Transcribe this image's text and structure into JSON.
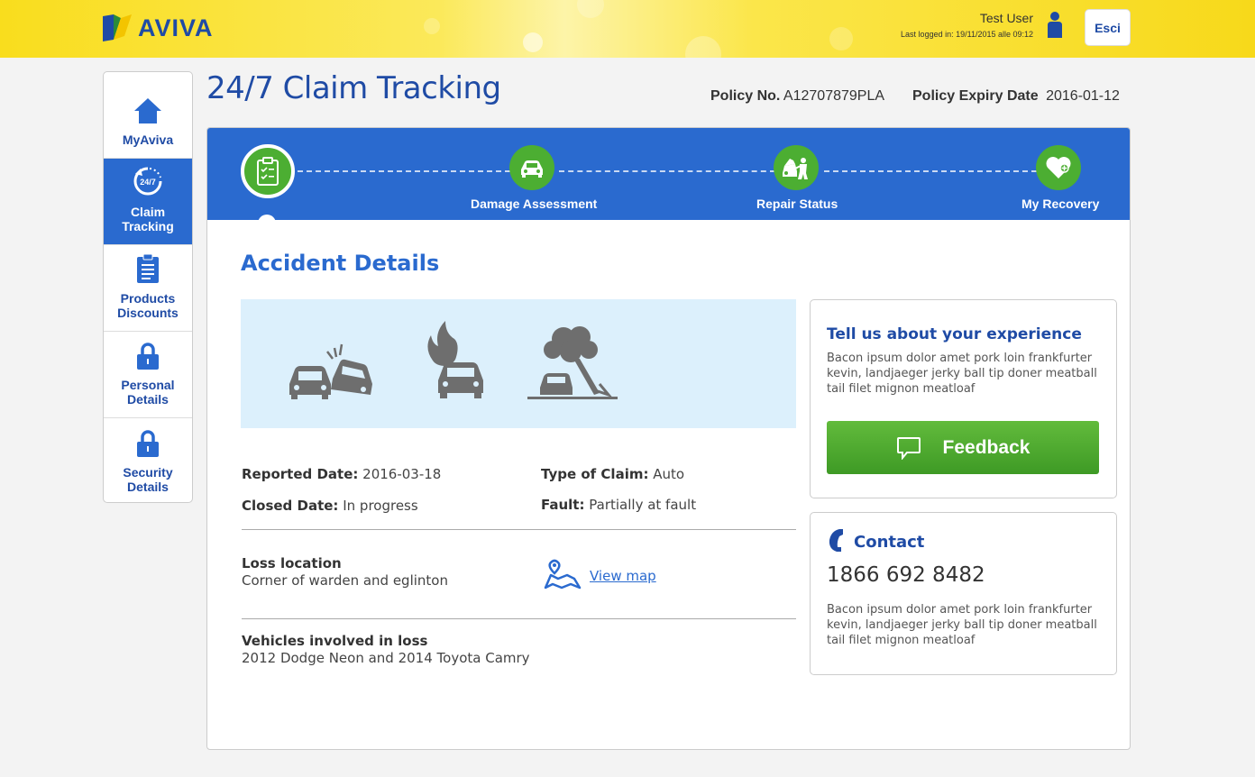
{
  "header": {
    "brand": "AVIVA",
    "user_name": "Test User",
    "last_logged": "Last logged in: 19/11/2015 alle 09:12",
    "logout_label": "Esci"
  },
  "sidebar": {
    "items": [
      {
        "label": "MyAviva",
        "icon": "home-icon",
        "active": false
      },
      {
        "label_line1": "Claim",
        "label_line2": "Tracking",
        "icon": "clock-24-7-icon",
        "active": true
      },
      {
        "label_line1": "Products",
        "label_line2": "Discounts",
        "icon": "clipboard-icon",
        "active": false
      },
      {
        "label_line1": "Personal",
        "label_line2": "Details",
        "icon": "lock-icon",
        "active": false
      },
      {
        "label_line1": "Security",
        "label_line2": "Details",
        "icon": "lock-icon",
        "active": false
      }
    ]
  },
  "page": {
    "title": "24/7 Claim Tracking",
    "policy_no_label": "Policy No.",
    "policy_no": "A12707879PLA",
    "expiry_label": "Policy Expiry Date",
    "expiry_date": "2016-01-12"
  },
  "steps": [
    {
      "label": "",
      "icon": "clipboard-check-icon",
      "current": true
    },
    {
      "label": "Damage Assessment",
      "icon": "car-icon"
    },
    {
      "label": "Repair Status",
      "icon": "mechanic-icon"
    },
    {
      "label": "My Recovery",
      "icon": "heart-plus-icon"
    }
  ],
  "accident": {
    "title": "Accident Details",
    "icons": [
      "car-collision-icon",
      "car-fire-icon",
      "tree-fall-icon"
    ],
    "reported_label": "Reported Date:",
    "reported_value": "2016-03-18",
    "closed_label": "Closed Date:",
    "closed_value": "In progress",
    "type_label": "Type of Claim:",
    "type_value": "Auto",
    "fault_label": "Fault:",
    "fault_value": "Partially at fault",
    "location_label": "Loss location",
    "location_value": "Corner of warden and eglinton",
    "map_link": "View map",
    "vehicles_label": "Vehicles involved in loss",
    "vehicles_value": "2012 Dodge Neon and 2014 Toyota Camry"
  },
  "feedback_card": {
    "title": "Tell us about your experience",
    "text": "Bacon ipsum dolor amet pork loin frankfurter kevin, landjaeger jerky ball tip doner meatball tail filet mignon meatloaf",
    "button_label": "Feedback"
  },
  "contact_card": {
    "title": "Contact",
    "phone": "1866 692 8482",
    "text": "Bacon ipsum dolor amet pork loin frankfurter kevin, landjaeger jerky ball tip doner meatball tail filet mignon meatloaf"
  },
  "colors": {
    "brand_blue": "#1f4ba5",
    "step_blue": "#2a6acf",
    "green": "#4cae32",
    "yellow": "#f9dd1d",
    "light_blue": "#dcf0fc"
  }
}
